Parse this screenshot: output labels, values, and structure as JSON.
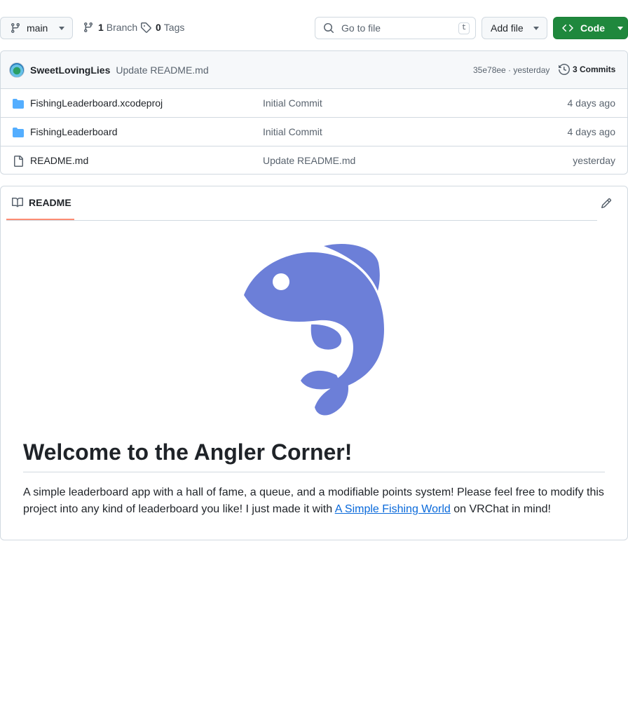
{
  "toolbar": {
    "branch_name": "main",
    "branch_count": "1",
    "branch_label": "Branch",
    "tag_count": "0",
    "tag_label": "Tags",
    "search_placeholder": "Go to file",
    "search_shortcut": "t",
    "add_file_label": "Add file",
    "code_label": "Code"
  },
  "latest_commit": {
    "author": "SweetLovingLies",
    "message": "Update README.md",
    "sha_time": "35e78ee · yesterday",
    "commits_label": "3 Commits"
  },
  "files": [
    {
      "name": "FishingLeaderboard.xcodeproj",
      "type": "folder",
      "commit": "Initial Commit",
      "age": "4 days ago"
    },
    {
      "name": "FishingLeaderboard",
      "type": "folder",
      "commit": "Initial Commit",
      "age": "4 days ago"
    },
    {
      "name": "README.md",
      "type": "file",
      "commit": "Update README.md",
      "age": "yesterday"
    }
  ],
  "readme": {
    "tab_label": "README",
    "title": "Welcome to the Angler Corner!",
    "text_before": "A simple leaderboard app with a hall of fame, a queue, and a modifiable points system! Please feel free to modify this project into any kind of leaderboard you like! I just made it with ",
    "link_text": "A Simple Fishing World",
    "text_after": " on VRChat in mind!",
    "fish_color": "#6c7fd8"
  },
  "colors": {
    "accent_green": "#1f883d",
    "folder_blue": "#54aeff",
    "tab_underline": "#fd8c73",
    "link": "#0969da"
  }
}
